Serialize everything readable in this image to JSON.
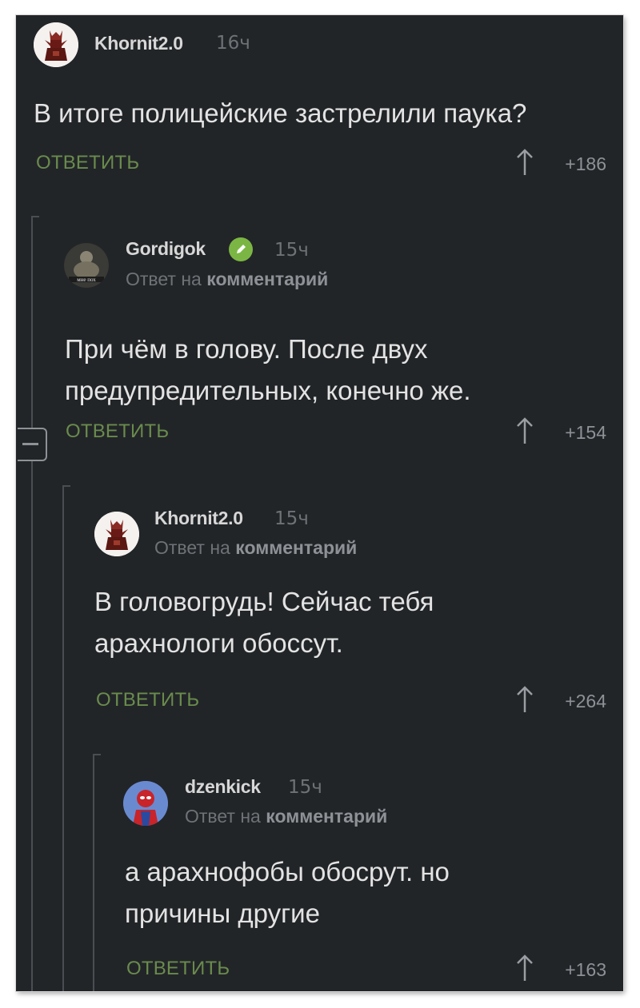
{
  "colors": {
    "background": "#222528",
    "accent_green": "#6a8b4d",
    "text": "#e3e3e3",
    "muted": "#6e7276"
  },
  "comments": [
    {
      "username": "Khornit2.0",
      "time": "16ч",
      "text": "В итоге полицейские застрелили паука?",
      "reply_label": "ОТВЕТИТЬ",
      "rating": "+186",
      "avatar_icon": "statue-avatar-icon"
    },
    {
      "username": "Gordigok",
      "time": "15ч",
      "reply_prefix": "Ответ на",
      "reply_target": "комментарий",
      "text_line1": "При чём в голову. После двух",
      "text_line2": "предупредительных, конечно же.",
      "reply_label": "ОТВЕТИТЬ",
      "rating": "+154",
      "avatar_icon": "buddha-avatar-icon",
      "avatar_caption": "мне пох",
      "badge_icon": "verified-pencil-icon"
    },
    {
      "username": "Khornit2.0",
      "time": "15ч",
      "reply_prefix": "Ответ на",
      "reply_target": "комментарий",
      "text_line1": "В головогрудь! Сейчас тебя",
      "text_line2": "арахнологи обоссут.",
      "reply_label": "ОТВЕТИТЬ",
      "rating": "+264",
      "avatar_icon": "statue-avatar-icon"
    },
    {
      "username": "dzenkick",
      "time": "15ч",
      "reply_prefix": "Ответ на",
      "reply_target": "комментарий",
      "text_line1": "а арахнофобы обосрут. но",
      "text_line2": "причины другие",
      "reply_label": "ОТВЕТИТЬ",
      "rating": "+163",
      "avatar_icon": "spiderman-avatar-icon"
    }
  ]
}
